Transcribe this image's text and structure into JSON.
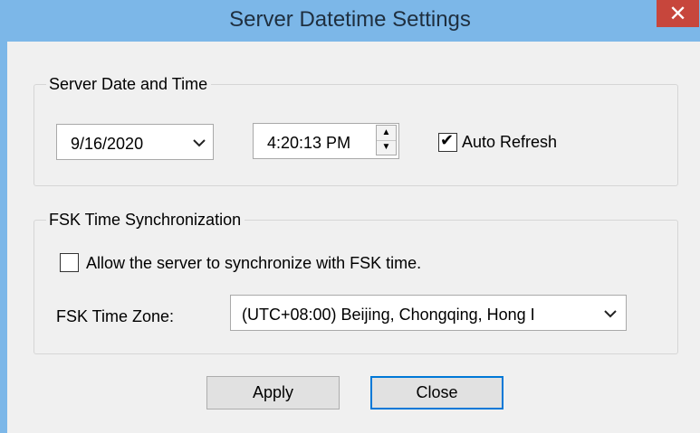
{
  "window": {
    "title": "Server Datetime Settings",
    "close_glyph": "✕"
  },
  "server_group": {
    "legend": "Server Date and Time",
    "date_value": "9/16/2020",
    "time_value": "4:20:13 PM",
    "auto_refresh_label": "Auto Refresh",
    "auto_refresh_checked": true,
    "auto_refresh_check_glyph": "✔"
  },
  "fsk_group": {
    "legend": "FSK Time Synchronization",
    "allow_sync_label": "Allow the server to synchronize with FSK time.",
    "allow_sync_checked": false,
    "time_zone_label": "FSK Time Zone:",
    "time_zone_value": "(UTC+08:00) Beijing, Chongqing, Hong I"
  },
  "buttons": {
    "apply": "Apply",
    "close": "Close"
  },
  "icons": {
    "dropdown": "chevron-down-icon",
    "spin_up": "triangle-up-icon",
    "spin_down": "triangle-down-icon",
    "check": "checkmark-icon"
  },
  "colors": {
    "titlebar": "#7cb7e8",
    "close_button": "#c7463c",
    "client_bg": "#f0f0f0",
    "accent_border": "#0078d7"
  }
}
